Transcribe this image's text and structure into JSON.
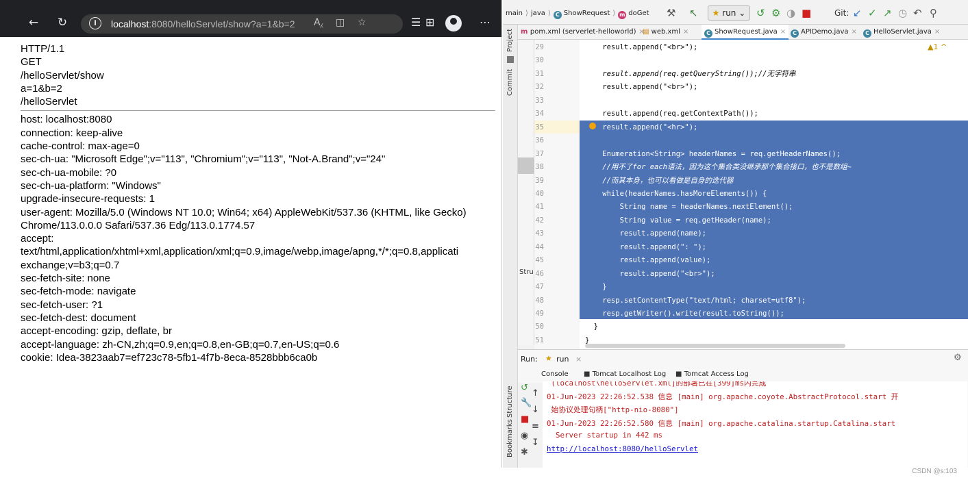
{
  "browser": {
    "url_host": "localhost",
    "url_rest": ":8080/helloServlet/show?a=1&b=2",
    "icons": {
      "back": "back-arrow-icon",
      "refresh": "refresh-icon",
      "info": "info-icon",
      "read_aloud": "read-aloud-icon",
      "split": "split-screen-icon",
      "favorite": "favorite-star-icon",
      "favorites_list": "favorites-list-icon",
      "collections": "collections-icon",
      "profile": "profile-avatar-icon",
      "more": "more-menu-icon"
    },
    "top_lines": [
      "HTTP/1.1",
      "GET",
      "/helloServlet/show",
      "a=1&b=2",
      "/helloServlet"
    ],
    "header_lines": [
      "host: localhost:8080",
      "connection: keep-alive",
      "cache-control: max-age=0",
      "sec-ch-ua: \"Microsoft Edge\";v=\"113\", \"Chromium\";v=\"113\", \"Not-A.Brand\";v=\"24\"",
      "sec-ch-ua-mobile: ?0",
      "sec-ch-ua-platform: \"Windows\"",
      "upgrade-insecure-requests: 1",
      "user-agent: Mozilla/5.0 (Windows NT 10.0; Win64; x64) AppleWebKit/537.36 (KHTML, like Gecko)",
      "Chrome/113.0.0.0 Safari/537.36 Edg/113.0.1774.57",
      "accept:",
      "text/html,application/xhtml+xml,application/xml;q=0.9,image/webp,image/apng,*/*;q=0.8,applicati",
      "exchange;v=b3;q=0.7",
      "sec-fetch-site: none",
      "sec-fetch-mode: navigate",
      "sec-fetch-user: ?1",
      "sec-fetch-dest: document",
      "accept-encoding: gzip, deflate, br",
      "accept-language: zh-CN,zh;q=0.9,en;q=0.8,en-GB;q=0.7,en-US;q=0.6",
      "cookie: Idea-3823aab7=ef723c78-5fb1-4f7b-8eca-8528bbb6ca0b"
    ]
  },
  "ide": {
    "breadcrumb": [
      "main",
      "java",
      "ShowRequest",
      "doGet"
    ],
    "run_config": "run",
    "git_label": "Git:",
    "sidebar": {
      "project": "Project",
      "commit": "Commit",
      "structure": "Structure",
      "bookmarks": "Bookmarks",
      "struct_pane": "Stru"
    },
    "tabs": [
      {
        "label": "pom.xml (serverlet-helloworld)",
        "active": false
      },
      {
        "label": "web.xml",
        "active": false
      },
      {
        "label": "ShowRequest.java",
        "active": true
      },
      {
        "label": "APIDemo.java",
        "active": false
      },
      {
        "label": "HelloServlet.java",
        "active": false
      }
    ],
    "warning": "▲1 ^",
    "code_lines": [
      {
        "no": "29",
        "text": "    result.append(\"<br>\");"
      },
      {
        "no": "30",
        "text": ""
      },
      {
        "no": "31",
        "text": "    result.append(req.getQueryString());//无字符串"
      },
      {
        "no": "32",
        "text": "    result.append(\"<br>\");"
      },
      {
        "no": "33",
        "text": ""
      },
      {
        "no": "34",
        "text": "    result.append(req.getContextPath());"
      },
      {
        "no": "35",
        "text": "    result.append(\"<hr>\");"
      },
      {
        "no": "36",
        "text": ""
      },
      {
        "no": "37",
        "text": "    Enumeration<String> headerNames = req.getHeaderNames();"
      },
      {
        "no": "38",
        "text": "    //用不了for each语法，因为这个集合类没继承那个集合接口，也不是数组~"
      },
      {
        "no": "39",
        "text": "    //而其本身，也可以看做是自身的迭代器"
      },
      {
        "no": "40",
        "text": "    while(headerNames.hasMoreElements()) {"
      },
      {
        "no": "41",
        "text": "        String name = headerNames.nextElement();"
      },
      {
        "no": "42",
        "text": "        String value = req.getHeader(name);"
      },
      {
        "no": "43",
        "text": "        result.append(name);"
      },
      {
        "no": "44",
        "text": "        result.append(\": \");"
      },
      {
        "no": "45",
        "text": "        result.append(value);"
      },
      {
        "no": "46",
        "text": "        result.append(\"<br>\");"
      },
      {
        "no": "47",
        "text": "    }"
      },
      {
        "no": "48",
        "text": "    resp.setContentType(\"text/html; charset=utf8\");"
      },
      {
        "no": "49",
        "text": "    resp.getWriter().write(result.toString());"
      },
      {
        "no": "50",
        "text": "  }"
      },
      {
        "no": "51",
        "text": "}"
      }
    ],
    "run_panel": {
      "label": "Run:",
      "config": "run",
      "tabs": [
        "Console",
        "Tomcat Localhost Log",
        "Tomcat Access Log"
      ],
      "console_lines": [
        {
          "text": " (localhost\\helloServlet.xml]的部署已在[399]ms内完成",
          "link": false
        },
        {
          "text": "01-Jun-2023 22:26:52.538 信息 [main] org.apache.coyote.AbstractProtocol.start 开",
          "link": false
        },
        {
          "text": " 始协议处理句柄[\"http-nio-8080\"]",
          "link": false
        },
        {
          "text": "01-Jun-2023 22:26:52.580 信息 [main] org.apache.catalina.startup.Catalina.start",
          "link": false
        },
        {
          "text": "  Server startup in 442 ms",
          "link": false
        },
        {
          "text": "http://localhost:8080/helloServlet",
          "link": true
        }
      ]
    }
  },
  "watermark": "CSDN @s:103"
}
